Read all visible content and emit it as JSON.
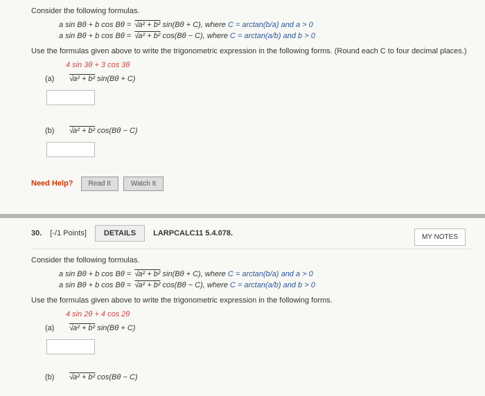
{
  "q1": {
    "prompt": "Consider the following formulas.",
    "formula1_lhs": "a sin Bθ + b cos Bθ = ",
    "formula1_rhs": "a² + b²",
    "formula1_tail": " sin(Bθ + C), where ",
    "formula1_cond": "C = arctan(b/a) and a > 0",
    "formula2_lhs": "a sin Bθ + b cos Bθ = ",
    "formula2_rhs": "a² + b²",
    "formula2_tail": " cos(Bθ − C), where ",
    "formula2_cond": "C = arctan(a/b) and b > 0",
    "instruction": "Use the formulas given above to write the trigonometric expression in the following forms. (Round each C to four decimal places.)",
    "given": "4 sin 3θ + 3 cos 3θ",
    "partA_label": "(a)",
    "partA_sqrt": "a² + b²",
    "partA_tail": " sin(Bθ + C)",
    "partB_label": "(b)",
    "partB_sqrt": "a² + b²",
    "partB_tail": " cos(Bθ − C)"
  },
  "help": {
    "label": "Need Help?",
    "read": "Read It",
    "watch": "Watch It"
  },
  "q2": {
    "number": "30.",
    "points": "[-/1 Points]",
    "details": "DETAILS",
    "source": "LARPCALC11 5.4.078.",
    "notes": "MY NOTES",
    "prompt": "Consider the following formulas.",
    "formula1_lhs": "a sin Bθ + b cos Bθ = ",
    "formula1_rhs": "a² + b²",
    "formula1_tail": " sin(Bθ + C), where ",
    "formula1_cond": "C = arctan(b/a) and a > 0",
    "formula2_lhs": "a sin Bθ + b cos Bθ = ",
    "formula2_rhs": "a² + b²",
    "formula2_tail": " cos(Bθ − C), where ",
    "formula2_cond": "C = arctan(a/b) and b > 0",
    "instruction": "Use the formulas given above to write the trigonometric expression in the following forms.",
    "given": "4 sin 2θ + 4 cos 2θ",
    "partA_label": "(a)",
    "partA_sqrt": "a² + b²",
    "partA_tail": " sin(Bθ + C)",
    "partB_label": "(b)",
    "partB_sqrt": "a² + b²",
    "partB_tail": " cos(Bθ − C)"
  }
}
